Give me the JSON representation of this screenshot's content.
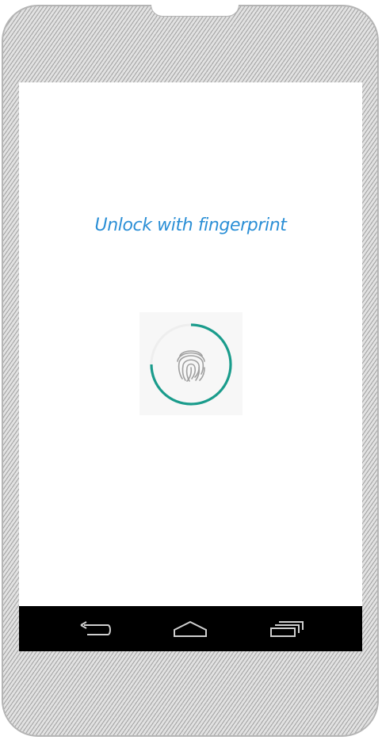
{
  "screen": {
    "title": "Unlock with fingerprint"
  },
  "fingerprint": {
    "icon": "fingerprint-icon",
    "progress": 0.75,
    "ring_color": "#1a9c8c",
    "track_color": "#eeeeee",
    "icon_color": "#9e9e9e"
  },
  "navbar": {
    "buttons": [
      {
        "icon": "back-icon"
      },
      {
        "icon": "home-icon"
      },
      {
        "icon": "recents-icon"
      }
    ]
  },
  "colors": {
    "title": "#2b8fd6",
    "navbar": "#000000"
  }
}
